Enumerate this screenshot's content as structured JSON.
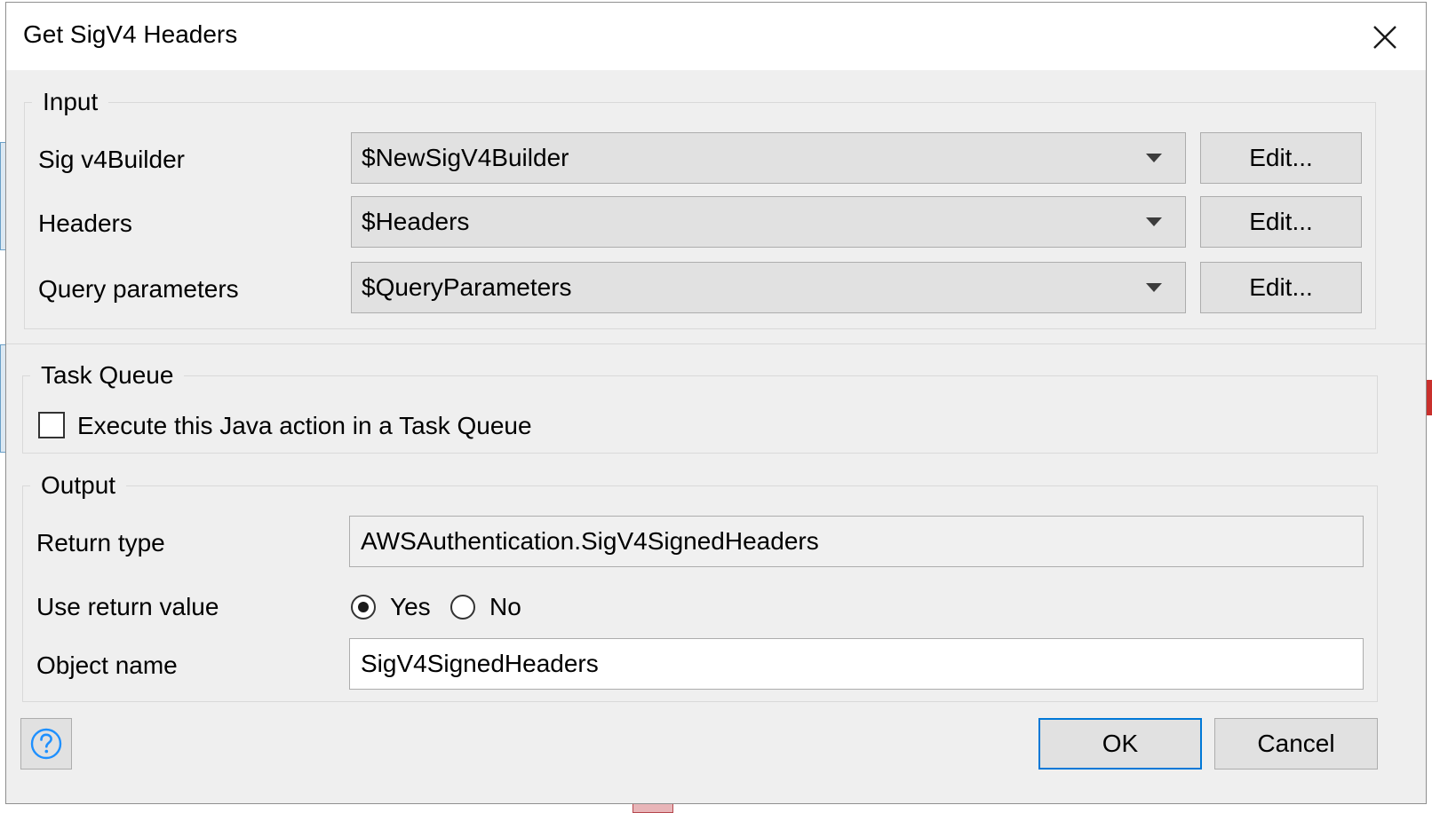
{
  "dialog": {
    "title": "Get SigV4 Headers",
    "close_icon": "close-icon"
  },
  "input_section": {
    "legend": "Input",
    "rows": [
      {
        "label": "Sig v4Builder",
        "value": "$NewSigV4Builder",
        "edit_label": "Edit..."
      },
      {
        "label": "Headers",
        "value": "$Headers",
        "edit_label": "Edit..."
      },
      {
        "label": "Query parameters",
        "value": "$QueryParameters",
        "edit_label": "Edit..."
      }
    ]
  },
  "task_queue_section": {
    "legend": "Task Queue",
    "checkbox_label": "Execute this Java action in a Task Queue",
    "checked": false
  },
  "output_section": {
    "legend": "Output",
    "return_type_label": "Return type",
    "return_type_value": "AWSAuthentication.SigV4SignedHeaders",
    "use_return_label": "Use return value",
    "yes_label": "Yes",
    "no_label": "No",
    "selected": "Yes",
    "object_name_label": "Object name",
    "object_name_value": "SigV4SignedHeaders"
  },
  "footer": {
    "help_icon": "help-icon",
    "ok_label": "OK",
    "cancel_label": "Cancel"
  },
  "colors": {
    "accent": "#0078d7",
    "dialog_bg": "#efefef",
    "button_bg": "#e1e1e1",
    "help_icon": "#1e90ff"
  }
}
